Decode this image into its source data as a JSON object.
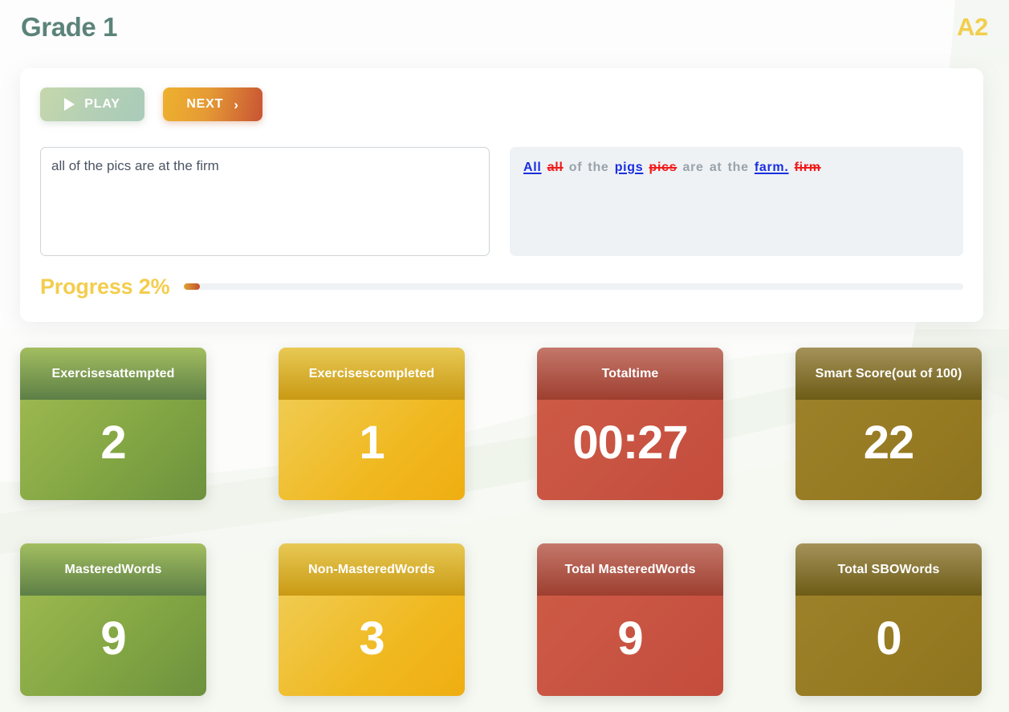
{
  "header": {
    "grade_title": "Grade 1",
    "level_badge": "A2"
  },
  "colors": {
    "grade_title": "#5b8379",
    "level_badge": "#f2ce4e",
    "progress_label": "#f3cd4d",
    "insert_word": "#1a2fe0",
    "delete_word": "#f01b1b",
    "unchanged_word": "#9aa3ab",
    "green_card": "#7fa342",
    "yellow_card": "#f0b81f",
    "red_card": "#c75241",
    "olive_card": "#957a22"
  },
  "toolbar": {
    "play_label": "PLAY",
    "play_icon": "play-triangle-icon",
    "next_label": "NEXT",
    "next_icon": "chevron-right-icon"
  },
  "answer": {
    "value": "all of the pics are at the firm",
    "placeholder": "",
    "resize_handle_icon": "resize-handle-icon"
  },
  "correction": {
    "tokens": [
      {
        "text": "All",
        "type": "insert"
      },
      {
        "text": "all",
        "type": "delete"
      },
      {
        "text": "of",
        "type": "same"
      },
      {
        "text": "the",
        "type": "same"
      },
      {
        "text": "pigs",
        "type": "insert"
      },
      {
        "text": "pics",
        "type": "delete"
      },
      {
        "text": "are",
        "type": "same"
      },
      {
        "text": "at",
        "type": "same"
      },
      {
        "text": "the",
        "type": "same"
      },
      {
        "text": "farm.",
        "type": "insert"
      },
      {
        "text": "firm",
        "type": "delete"
      }
    ]
  },
  "progress": {
    "label": "Progress 2%",
    "percent": 2
  },
  "stats": {
    "row1": [
      {
        "title_line1": "Exercises",
        "title_line2": "attempted",
        "value": "2",
        "theme": "green"
      },
      {
        "title_line1": "Exercises",
        "title_line2": "completed",
        "value": "1",
        "theme": "yellow"
      },
      {
        "title_line1": "Total",
        "title_line2": "time",
        "value": "00:27",
        "theme": "red"
      },
      {
        "title_line1": "Smart Score",
        "title_line2": "(out of 100)",
        "value": "22",
        "theme": "olive"
      }
    ],
    "row2": [
      {
        "title_line1": "Mastered",
        "title_line2": "Words",
        "value": "9",
        "theme": "green"
      },
      {
        "title_line1": "Non-Mastered",
        "title_line2": "Words",
        "value": "3",
        "theme": "yellow"
      },
      {
        "title_line1": "Total Mastered",
        "title_line2": "Words",
        "value": "9",
        "theme": "red"
      },
      {
        "title_line1": "Total SBO",
        "title_line2": "Words",
        "value": "0",
        "theme": "olive"
      }
    ]
  }
}
